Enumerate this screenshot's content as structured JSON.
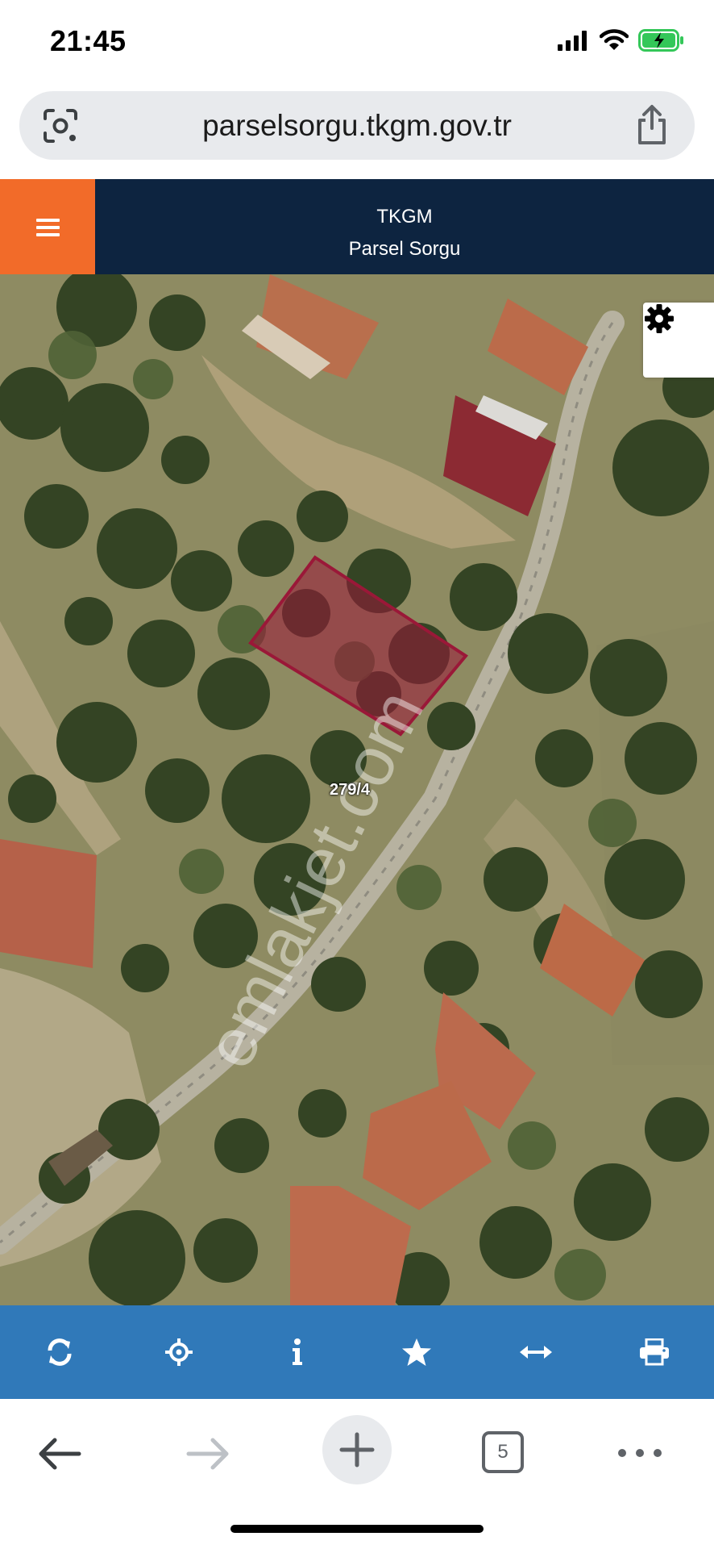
{
  "status_bar": {
    "time": "21:45"
  },
  "browser": {
    "url": "parselsorgu.tkgm.gov.tr",
    "tab_count": "5"
  },
  "app": {
    "title": "TKGM",
    "subtitle": "Parsel Sorgu",
    "accent": "#f26b29",
    "header_bg": "#0d2440",
    "toolbar_bg": "#3079b9"
  },
  "map": {
    "parcel_label": "279/4",
    "parcel_color": "#9a1838",
    "watermark": "emlakjet.com"
  },
  "toolbar": {
    "icons": [
      "refresh-icon",
      "locate-icon",
      "info-icon",
      "star-icon",
      "measure-icon",
      "print-icon"
    ]
  }
}
